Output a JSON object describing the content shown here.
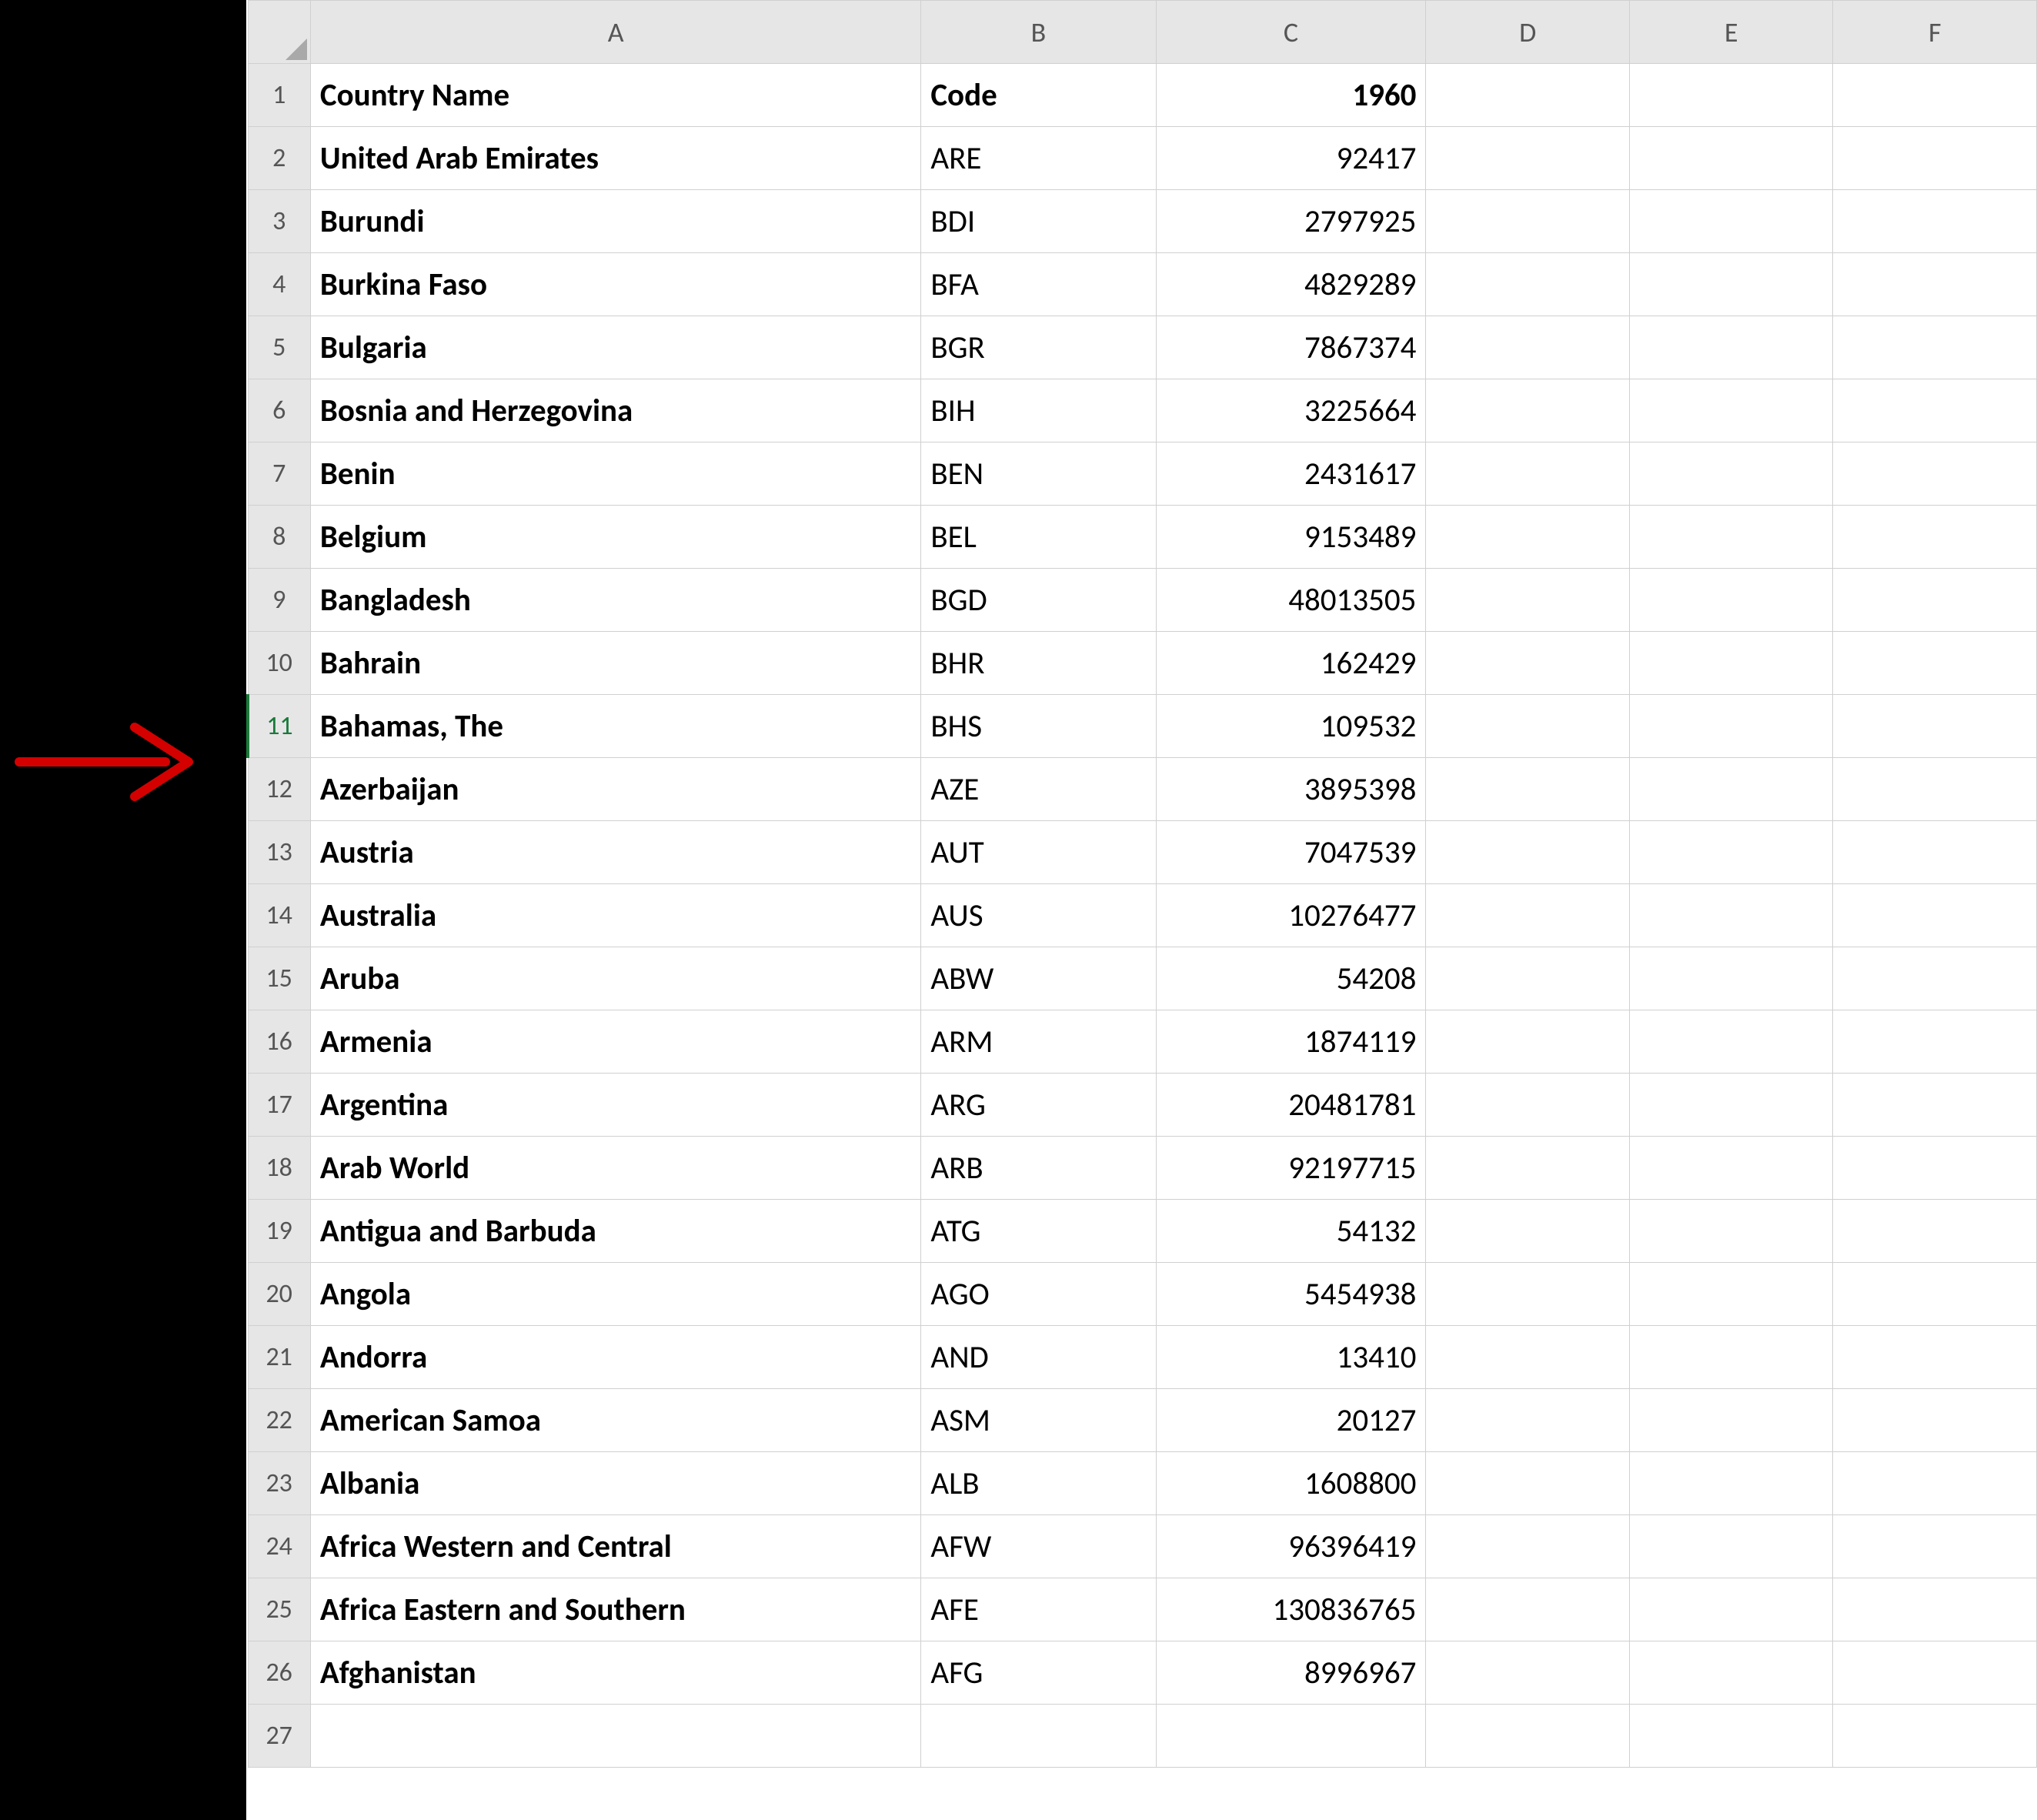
{
  "columns": [
    "A",
    "B",
    "C",
    "D",
    "E",
    "F"
  ],
  "highlighted_row": 11,
  "header_row": {
    "country": "Country Name",
    "code": "Code",
    "year": "1960"
  },
  "rows": [
    {
      "n": 2,
      "country": "United Arab Emirates",
      "code": "ARE",
      "value": "92417"
    },
    {
      "n": 3,
      "country": "Burundi",
      "code": "BDI",
      "value": "2797925"
    },
    {
      "n": 4,
      "country": "Burkina Faso",
      "code": "BFA",
      "value": "4829289"
    },
    {
      "n": 5,
      "country": "Bulgaria",
      "code": "BGR",
      "value": "7867374"
    },
    {
      "n": 6,
      "country": "Bosnia and Herzegovina",
      "code": "BIH",
      "value": "3225664"
    },
    {
      "n": 7,
      "country": "Benin",
      "code": "BEN",
      "value": "2431617"
    },
    {
      "n": 8,
      "country": "Belgium",
      "code": "BEL",
      "value": "9153489"
    },
    {
      "n": 9,
      "country": "Bangladesh",
      "code": "BGD",
      "value": "48013505"
    },
    {
      "n": 10,
      "country": "Bahrain",
      "code": "BHR",
      "value": "162429"
    },
    {
      "n": 11,
      "country": "Bahamas, The",
      "code": "BHS",
      "value": "109532"
    },
    {
      "n": 12,
      "country": "Azerbaijan",
      "code": "AZE",
      "value": "3895398"
    },
    {
      "n": 13,
      "country": "Austria",
      "code": "AUT",
      "value": "7047539"
    },
    {
      "n": 14,
      "country": "Australia",
      "code": "AUS",
      "value": "10276477"
    },
    {
      "n": 15,
      "country": "Aruba",
      "code": "ABW",
      "value": "54208"
    },
    {
      "n": 16,
      "country": "Armenia",
      "code": "ARM",
      "value": "1874119"
    },
    {
      "n": 17,
      "country": "Argentina",
      "code": "ARG",
      "value": "20481781"
    },
    {
      "n": 18,
      "country": "Arab World",
      "code": "ARB",
      "value": "92197715"
    },
    {
      "n": 19,
      "country": "Antigua and Barbuda",
      "code": "ATG",
      "value": "54132"
    },
    {
      "n": 20,
      "country": "Angola",
      "code": "AGO",
      "value": "5454938"
    },
    {
      "n": 21,
      "country": "Andorra",
      "code": "AND",
      "value": "13410"
    },
    {
      "n": 22,
      "country": "American Samoa",
      "code": "ASM",
      "value": "20127"
    },
    {
      "n": 23,
      "country": "Albania",
      "code": "ALB",
      "value": "1608800"
    },
    {
      "n": 24,
      "country": "Africa Western and Central",
      "code": "AFW",
      "value": "96396419"
    },
    {
      "n": 25,
      "country": "Africa Eastern and Southern",
      "code": "AFE",
      "value": "130836765"
    },
    {
      "n": 26,
      "country": "Afghanistan",
      "code": "AFG",
      "value": "8996967"
    }
  ],
  "empty_rows": [
    27
  ],
  "annotation": {
    "type": "arrow",
    "color": "#d40000"
  }
}
